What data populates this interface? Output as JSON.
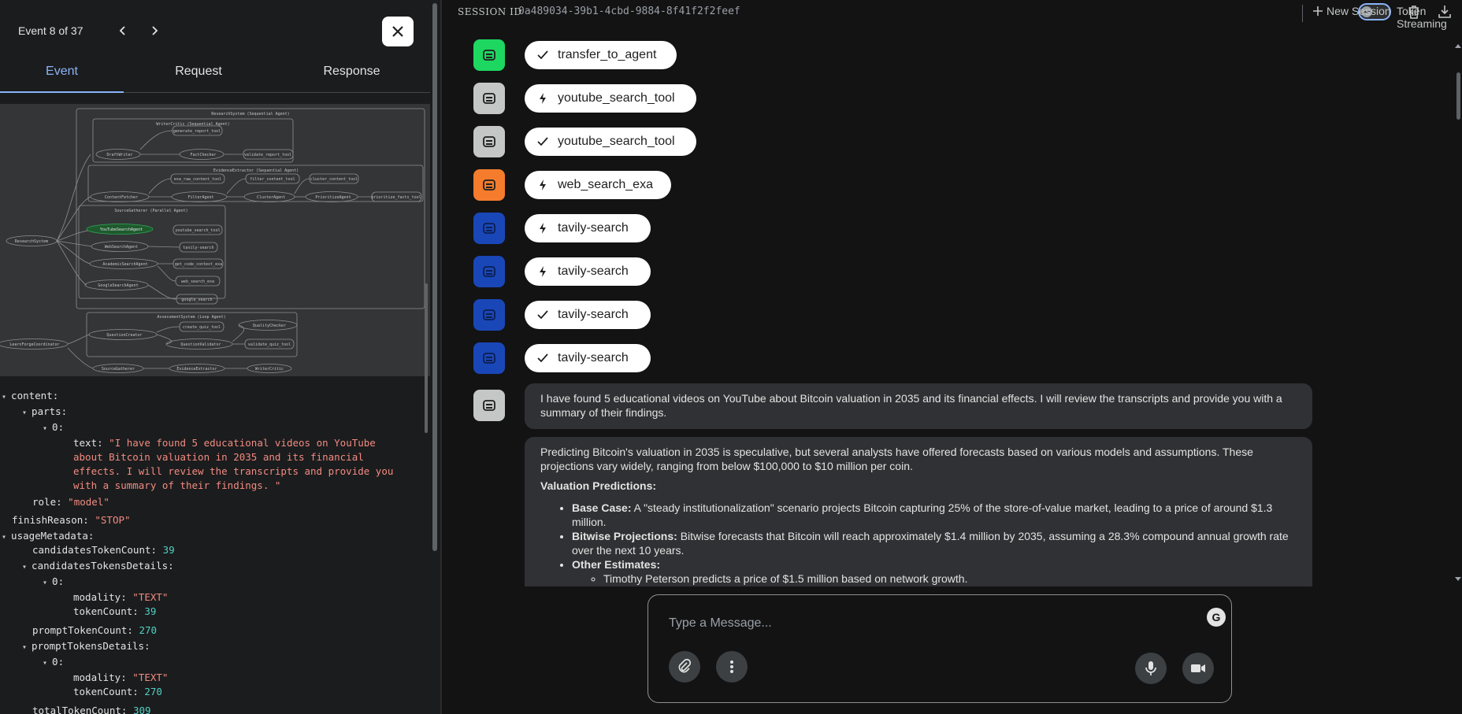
{
  "event_panel": {
    "counter": "Event 8 of 37",
    "tabs": [
      "Event",
      "Request",
      "Response"
    ],
    "active_tab": "Event"
  },
  "graph": {
    "clusters": [
      "ResearchSystem (Sequential Agent)",
      "WriterCritic (Sequential Agent)",
      "EvidenceExtractor (Sequential Agent)",
      "SourceGatherer (Parallel Agent)",
      "AssessmentSystem (Loop Agent)"
    ],
    "nodes": [
      "generate_report_tool",
      "DraftWriter",
      "FactChecker",
      "validate_report_tool",
      "exa_raw_content_tool",
      "filter_content_tool",
      "cluster_content_tool",
      "ContentFetcher",
      "FilterAgent",
      "ClusterAgent",
      "PrioritizeAgent",
      "prioritize_facts_tool",
      "ResearchSystem",
      "YouTubeSearchAgent",
      "youtube_search_tool",
      "WebSearchAgent",
      "tavily-search",
      "AcademicSearchAgent",
      "get_code_context_exa",
      "web_search_exa",
      "GoogleSearchAgent",
      "google_search",
      "create_quiz_tool",
      "QualityChecker",
      "QuestionCreator",
      "QuestionValidator",
      "validate_quiz_tool",
      "LearnForgeCoordinator",
      "SourceGatherer",
      "EvidenceExtractor",
      "WriterCritic"
    ],
    "highlighted": "YouTubeSearchAgent"
  },
  "event_json": {
    "content_key": "content:",
    "parts_key": "parts:",
    "idx0": "0:",
    "text_key": "text:",
    "text_lines": [
      "\"I have found 5 educational videos on YouTube",
      "about Bitcoin valuation in 2035 and its financial",
      "effects. I will review the transcripts and provide you",
      "with a summary of their findings. \""
    ],
    "role_key": "role:",
    "role_val": "\"model\"",
    "finish_key": "finishReason:",
    "finish_val": "\"STOP\"",
    "usage_key": "usageMetadata:",
    "cand_count_key": "candidatesTokenCount:",
    "cand_count_val": "39",
    "cand_details_key": "candidatesTokensDetails:",
    "modality_key": "modality:",
    "modality_val": "\"TEXT\"",
    "tokencount_key": "tokenCount:",
    "cand_token_val": "39",
    "prompt_count_key": "promptTokenCount:",
    "prompt_count_val": "270",
    "prompt_details_key": "promptTokensDetails:",
    "prompt_token_val": "270",
    "total_key": "totalTokenCount:",
    "total_val": "309"
  },
  "session": {
    "label": "SESSION ID",
    "id": "0a489034-39b1-4cbd-9884-8f41f2f2feef",
    "token_streaming_label": "Token Streaming",
    "new_session_label": "New Session"
  },
  "chat": {
    "events": [
      {
        "tool": "transfer_to_agent",
        "kind": "check",
        "color": "#1ed760"
      },
      {
        "tool": "youtube_search_tool",
        "kind": "bolt",
        "color": "#c4c7c5"
      },
      {
        "tool": "youtube_search_tool",
        "kind": "check",
        "color": "#c4c7c5"
      },
      {
        "tool": "web_search_exa",
        "kind": "bolt",
        "color": "#f47c2c"
      },
      {
        "tool": "tavily-search",
        "kind": "bolt",
        "color": "#1a47b8"
      },
      {
        "tool": "tavily-search",
        "kind": "bolt",
        "color": "#1a47b8"
      },
      {
        "tool": "tavily-search",
        "kind": "check",
        "color": "#1a47b8"
      },
      {
        "tool": "tavily-search",
        "kind": "check",
        "color": "#1a47b8"
      }
    ],
    "message1": "I have found 5 educational videos on YouTube about Bitcoin valuation in 2035 and its financial effects. I will review the transcripts and provide you with a summary of their findings.",
    "message2": {
      "intro": "Predicting Bitcoin's valuation in 2035 is speculative, but several analysts have offered forecasts based on various models and assumptions. These projections vary widely, ranging from below $100,000 to $10 million per coin.",
      "heading": "Valuation Predictions:",
      "items": [
        {
          "label": "Base Case:",
          "text": " A \"steady institutionalization\" scenario projects Bitcoin capturing 25% of the store-of-value market, leading to a price of around $1.3 million."
        },
        {
          "label": "Bitwise Projections:",
          "text": " Bitwise forecasts that Bitcoin will reach approximately $1.4 million by 2035, assuming a 28.3% compound annual growth rate over the next 10 years."
        },
        {
          "label": "Other Estimates:",
          "text": ""
        }
      ],
      "sub_item": "Timothy Peterson predicts a price of $1.5 million based on network growth."
    },
    "input_placeholder": "Type a Message...",
    "avatar_color_user": "#c4c7c5"
  }
}
